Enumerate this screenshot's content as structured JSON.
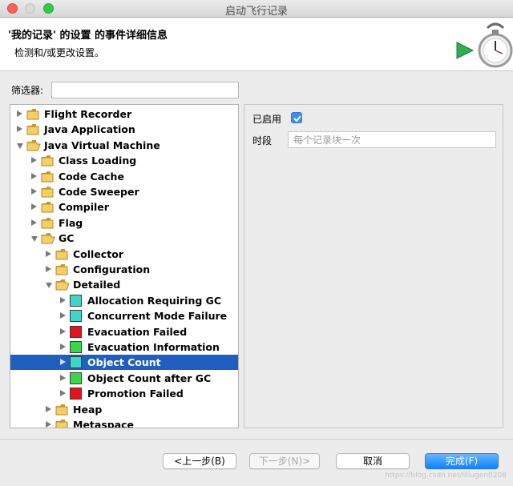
{
  "window": {
    "title": "启动飞行记录"
  },
  "header": {
    "title": "'我的记录' 的设置 的事件详细信息",
    "subtitle": "检测和/或更改设置。"
  },
  "filter": {
    "label": "筛选器:",
    "value": ""
  },
  "tree": [
    {
      "label": "Flight Recorder",
      "type": "folder",
      "level": 0,
      "expanded": false
    },
    {
      "label": "Java Application",
      "type": "folder",
      "level": 0,
      "expanded": false
    },
    {
      "label": "Java Virtual Machine",
      "type": "folder",
      "level": 0,
      "expanded": true
    },
    {
      "label": "Class Loading",
      "type": "folder",
      "level": 1,
      "expanded": false
    },
    {
      "label": "Code Cache",
      "type": "folder",
      "level": 1,
      "expanded": false
    },
    {
      "label": "Code Sweeper",
      "type": "folder",
      "level": 1,
      "expanded": false
    },
    {
      "label": "Compiler",
      "type": "folder",
      "level": 1,
      "expanded": false
    },
    {
      "label": "Flag",
      "type": "folder",
      "level": 1,
      "expanded": false
    },
    {
      "label": "GC",
      "type": "folder",
      "level": 1,
      "expanded": true
    },
    {
      "label": "Collector",
      "type": "folder",
      "level": 2,
      "expanded": false
    },
    {
      "label": "Configuration",
      "type": "folder",
      "level": 2,
      "expanded": false
    },
    {
      "label": "Detailed",
      "type": "folder",
      "level": 2,
      "expanded": true
    },
    {
      "label": "Allocation Requiring GC",
      "type": "event",
      "level": 3,
      "color": "#3fd6c8"
    },
    {
      "label": "Concurrent Mode Failure",
      "type": "event",
      "level": 3,
      "color": "#3fd6c8"
    },
    {
      "label": "Evacuation Failed",
      "type": "event",
      "level": 3,
      "color": "#e0141b"
    },
    {
      "label": "Evacuation Information",
      "type": "event",
      "level": 3,
      "color": "#3cd64a"
    },
    {
      "label": "Object Count",
      "type": "event",
      "level": 3,
      "color": "#3fd6c8",
      "selected": true
    },
    {
      "label": "Object Count after GC",
      "type": "event",
      "level": 3,
      "color": "#3cd64a"
    },
    {
      "label": "Promotion Failed",
      "type": "event",
      "level": 3,
      "color": "#e0141b"
    },
    {
      "label": "Heap",
      "type": "folder",
      "level": 2,
      "expanded": false
    },
    {
      "label": "Metaspace",
      "type": "folder",
      "level": 2,
      "expanded": false
    }
  ],
  "detail": {
    "enabled_label": "已启用",
    "enabled": true,
    "period_label": "时段",
    "period_placeholder": "每个记录块一次"
  },
  "buttons": {
    "back": "<上一步(B)",
    "next": "下一步(N)>",
    "cancel": "取消",
    "finish": "完成(F)"
  },
  "colors": {
    "accent": "#1f5fbf",
    "primary_button": "#0c82ff"
  },
  "watermark": "https://blog.csdn.net/liliugen0208"
}
